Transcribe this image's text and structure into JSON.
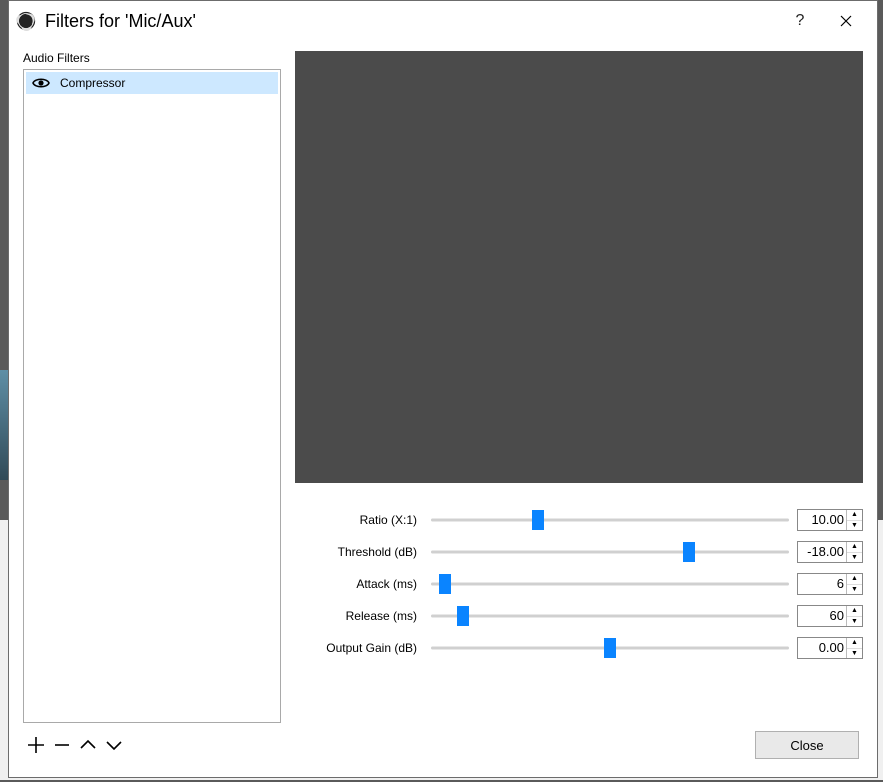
{
  "window": {
    "title": "Filters for 'Mic/Aux'"
  },
  "section_label": "Audio Filters",
  "filters": [
    {
      "name": "Compressor",
      "visible": true,
      "selected": true
    }
  ],
  "params": [
    {
      "label": "Ratio (X:1)",
      "value": "10.00",
      "slider_pct": 30
    },
    {
      "label": "Threshold (dB)",
      "value": "-18.00",
      "slider_pct": 72
    },
    {
      "label": "Attack (ms)",
      "value": "6",
      "slider_pct": 4
    },
    {
      "label": "Release (ms)",
      "value": "60",
      "slider_pct": 9
    },
    {
      "label": "Output Gain (dB)",
      "value": "0.00",
      "slider_pct": 50
    }
  ],
  "buttons": {
    "close": "Close"
  },
  "colors": {
    "selection": "#cde8ff",
    "accent": "#0a84ff",
    "preview_bg": "#4b4b4b"
  },
  "icons": {
    "app": "obs-logo",
    "help": "?",
    "close_window": "✕",
    "eye": "eye-icon",
    "add": "plus-icon",
    "remove": "minus-icon",
    "move_up": "chevron-up-icon",
    "move_down": "chevron-down-icon",
    "spin_up": "▲",
    "spin_down": "▼"
  }
}
